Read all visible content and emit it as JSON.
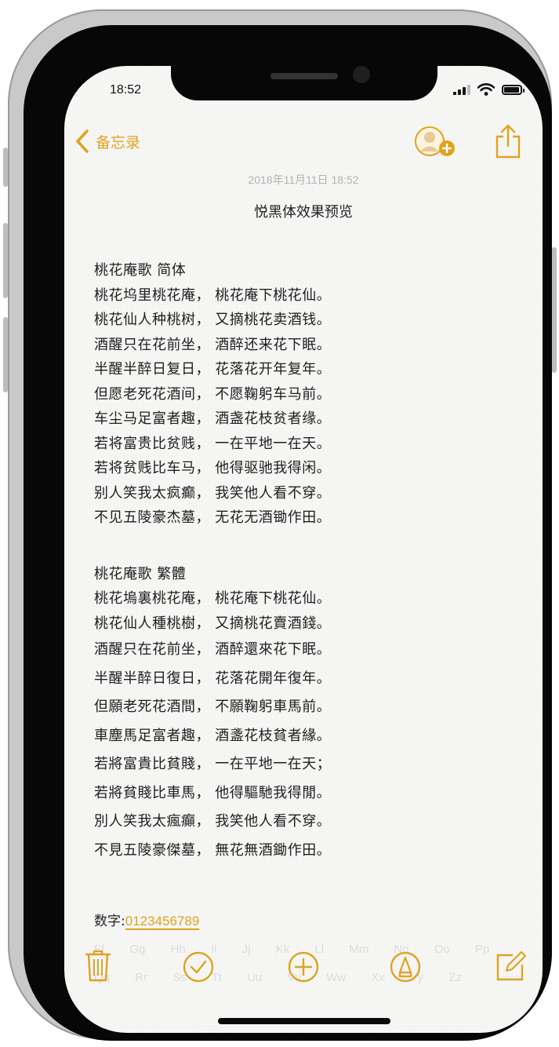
{
  "status_bar": {
    "time": "18:52"
  },
  "nav": {
    "back_label": "备忘录"
  },
  "note": {
    "date": "2018年11月11日  18:52",
    "title": "悦黑体效果预览",
    "simplified": {
      "heading": "桃花庵歌  简体",
      "lines": [
        "桃花坞里桃花庵，  桃花庵下桃花仙。",
        "桃花仙人种桃树，  又摘桃花卖酒钱。",
        "酒醒只在花前坐，  酒醉还来花下眠。",
        "半醒半醉日复日，  花落花开年复年。",
        "但愿老死花酒间，  不愿鞠躬车马前。",
        "车尘马足富者趣，  酒盏花枝贫者缘。",
        "若将富贵比贫贱，  一在平地一在天。",
        "若将贫贱比车马，  他得驱驰我得闲。",
        "别人笑我太疯癫，  我笑他人看不穿。",
        "不见五陵豪杰墓，  无花无酒锄作田。"
      ]
    },
    "traditional": {
      "heading": "桃花庵歌  繁體",
      "lines": [
        "桃花塢裏桃花庵，  桃花庵下桃花仙。",
        "桃花仙人種桃樹，  又摘桃花賣酒錢。",
        "酒醒只在花前坐，  酒醉還來花下眠。",
        "半醒半醉日復日，  花落花開年復年。",
        "但願老死花酒間，  不願鞠躬車馬前。",
        "車塵馬足富者趣，  酒盞花枝貧者緣。",
        "若將富貴比貧賤，  一在平地一在天；",
        "若將貧賤比車馬，  他得驅馳我得閒。",
        "別人笑我太瘋癲，  我笑他人看不穿。",
        "不見五陵豪傑墓，  無花無酒鋤作田。"
      ]
    },
    "digits_label": "数字:",
    "digits_value": "0123456789",
    "ghost_text": "Ff Gg Hh Ii Jj Kk Ll Mm Nn Oo Pp Qq Rr Ss Tt Uu Vv Ww Xx Yy Zz"
  },
  "colors": {
    "accent": "#e2a21e"
  },
  "icons": {
    "nav_back": "chevron-left-icon",
    "nav_share_people": "add-person-icon",
    "nav_share": "share-icon",
    "toolbar": [
      "trash-icon",
      "checkmark-circle-icon",
      "plus-circle-icon",
      "pen-markup-icon",
      "compose-icon"
    ]
  }
}
